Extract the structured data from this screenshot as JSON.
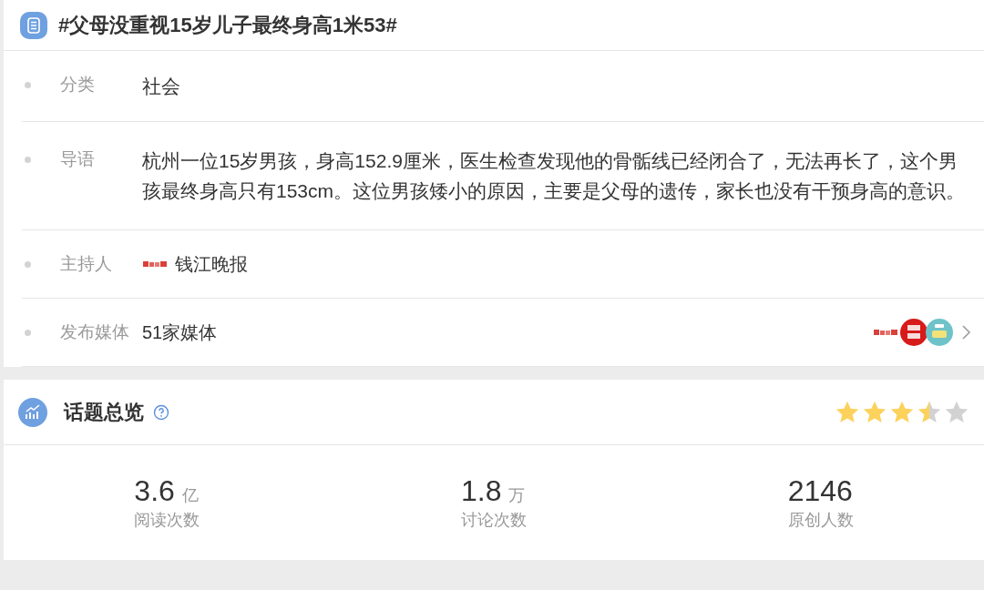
{
  "topic": {
    "title": "#父母没重视15岁儿子最终身高1米53#"
  },
  "fields": [
    {
      "kind": "text",
      "label": "分类",
      "value": "社会"
    },
    {
      "kind": "text",
      "label": "导语",
      "value": "杭州一位15岁男孩，身高152.9厘米，医生检查发现他的骨骺线已经闭合了，无法再长了，这个男孩最终身高只有153cm。这位男孩矮小的原因，主要是父母的遗传，家长也没有干预身高的意识。"
    },
    {
      "kind": "host",
      "label": "主持人",
      "value": "钱江晚报"
    },
    {
      "kind": "media",
      "label": "发布媒体",
      "value": "51家媒体"
    }
  ],
  "overview": {
    "title": "话题总览",
    "stars": 3.5,
    "stats": [
      {
        "value": "3.6",
        "unit": "亿",
        "label": "阅读次数"
      },
      {
        "value": "1.8",
        "unit": "万",
        "label": "讨论次数"
      },
      {
        "value": "2146",
        "label": "原创人数"
      }
    ]
  }
}
